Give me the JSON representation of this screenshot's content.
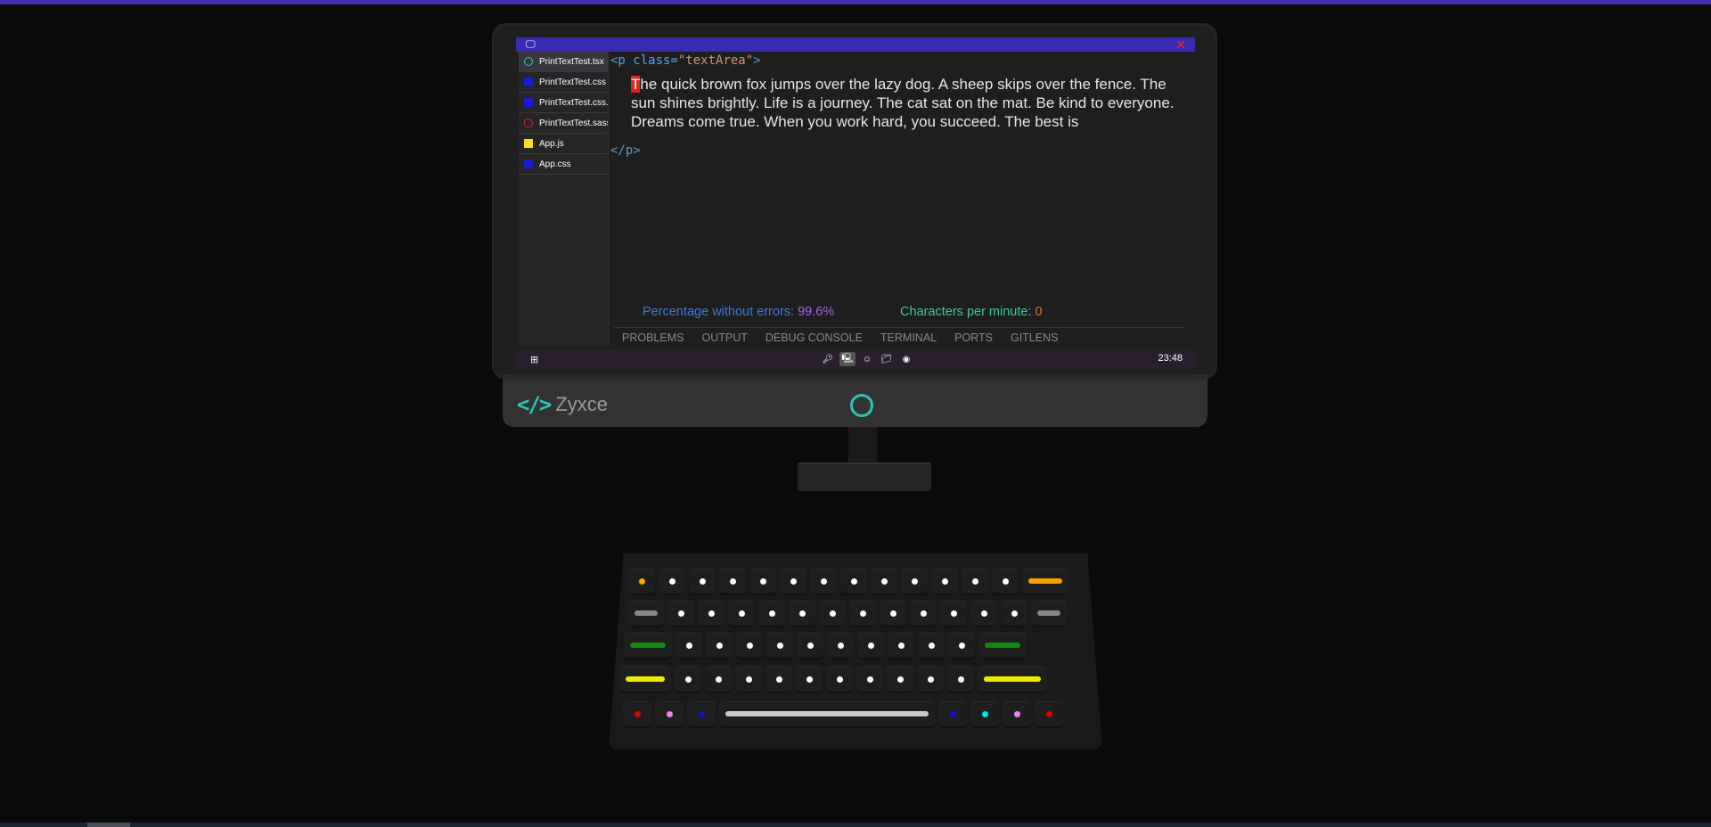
{
  "editor": {
    "tabs": [
      {
        "name": "PrintTextTest.tsx",
        "icon": "react-icon"
      },
      {
        "name": "PrintTextTest.css",
        "icon": "css-icon"
      },
      {
        "name": "PrintTextTest.css...",
        "icon": "css-icon"
      },
      {
        "name": "PrintTextTest.sass",
        "icon": "sass-icon"
      },
      {
        "name": "App.js",
        "icon": "js-icon"
      },
      {
        "name": "App.css",
        "icon": "css-icon"
      }
    ],
    "code_open_tag_start": "<p ",
    "code_attr": "class=",
    "code_attr_value": "\"textArea\"",
    "code_open_tag_end": ">",
    "code_close_tag": "</p>",
    "current_char": "T",
    "text_rest": "he quick brown fox jumps over the lazy dog. A sheep skips over the fence. The sun shines brightly. Life is a journey. The cat sat on the mat. Be kind to everyone. Dreams come true. When you work hard, you succeed. The best is",
    "stats": {
      "accuracy_label": "Percentage without errors: ",
      "accuracy_value": "99.6%",
      "cpm_label": "Characters per minute: ",
      "cpm_value": "0"
    },
    "panel_tabs": [
      "PROBLEMS",
      "OUTPUT",
      "DEBUG CONSOLE",
      "TERMINAL",
      "PORTS",
      "GITLENS"
    ]
  },
  "taskbar": {
    "clock": "23:48",
    "tray_icons": [
      "key-icon",
      "laptop-icon",
      "person-icon",
      "folder-icon",
      "github-icon"
    ]
  },
  "brand": {
    "logo": "</>",
    "name": "Zyxce"
  },
  "colors": {
    "accent": "#3a2bb3",
    "brand": "#2ec4b6",
    "caret": "#e02424"
  }
}
